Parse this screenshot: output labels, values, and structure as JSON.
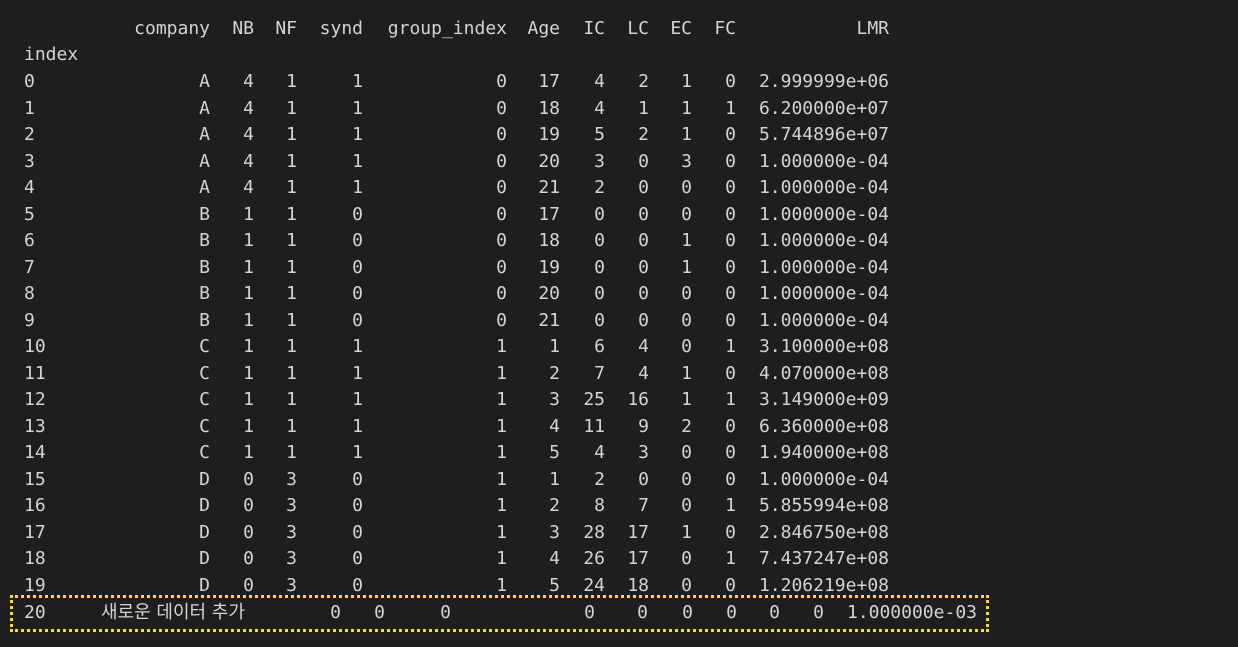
{
  "terminal": {
    "columns": [
      "company",
      "NB",
      "NF",
      "synd",
      "group_index",
      "Age",
      "IC",
      "LC",
      "EC",
      "FC",
      "LMR"
    ],
    "index_label": "index",
    "rows": [
      [
        "0",
        "A",
        "4",
        "1",
        "1",
        "0",
        "17",
        "4",
        "2",
        "1",
        "0",
        "2.999999e+06"
      ],
      [
        "1",
        "A",
        "4",
        "1",
        "1",
        "0",
        "18",
        "4",
        "1",
        "1",
        "1",
        "6.200000e+07"
      ],
      [
        "2",
        "A",
        "4",
        "1",
        "1",
        "0",
        "19",
        "5",
        "2",
        "1",
        "0",
        "5.744896e+07"
      ],
      [
        "3",
        "A",
        "4",
        "1",
        "1",
        "0",
        "20",
        "3",
        "0",
        "3",
        "0",
        "1.000000e-04"
      ],
      [
        "4",
        "A",
        "4",
        "1",
        "1",
        "0",
        "21",
        "2",
        "0",
        "0",
        "0",
        "1.000000e-04"
      ],
      [
        "5",
        "B",
        "1",
        "1",
        "0",
        "0",
        "17",
        "0",
        "0",
        "0",
        "0",
        "1.000000e-04"
      ],
      [
        "6",
        "B",
        "1",
        "1",
        "0",
        "0",
        "18",
        "0",
        "0",
        "1",
        "0",
        "1.000000e-04"
      ],
      [
        "7",
        "B",
        "1",
        "1",
        "0",
        "0",
        "19",
        "0",
        "0",
        "1",
        "0",
        "1.000000e-04"
      ],
      [
        "8",
        "B",
        "1",
        "1",
        "0",
        "0",
        "20",
        "0",
        "0",
        "0",
        "0",
        "1.000000e-04"
      ],
      [
        "9",
        "B",
        "1",
        "1",
        "0",
        "0",
        "21",
        "0",
        "0",
        "0",
        "0",
        "1.000000e-04"
      ],
      [
        "10",
        "C",
        "1",
        "1",
        "1",
        "1",
        "1",
        "6",
        "4",
        "0",
        "1",
        "3.100000e+08"
      ],
      [
        "11",
        "C",
        "1",
        "1",
        "1",
        "1",
        "2",
        "7",
        "4",
        "1",
        "0",
        "4.070000e+08"
      ],
      [
        "12",
        "C",
        "1",
        "1",
        "1",
        "1",
        "3",
        "25",
        "16",
        "1",
        "1",
        "3.149000e+09"
      ],
      [
        "13",
        "C",
        "1",
        "1",
        "1",
        "1",
        "4",
        "11",
        "9",
        "2",
        "0",
        "6.360000e+08"
      ],
      [
        "14",
        "C",
        "1",
        "1",
        "1",
        "1",
        "5",
        "4",
        "3",
        "0",
        "0",
        "1.940000e+08"
      ],
      [
        "15",
        "D",
        "0",
        "3",
        "0",
        "1",
        "1",
        "2",
        "0",
        "0",
        "0",
        "1.000000e-04"
      ],
      [
        "16",
        "D",
        "0",
        "3",
        "0",
        "1",
        "2",
        "8",
        "7",
        "0",
        "1",
        "5.855994e+08"
      ],
      [
        "17",
        "D",
        "0",
        "3",
        "0",
        "1",
        "3",
        "28",
        "17",
        "1",
        "0",
        "2.846750e+08"
      ],
      [
        "18",
        "D",
        "0",
        "3",
        "0",
        "1",
        "4",
        "26",
        "17",
        "0",
        "1",
        "7.437247e+08"
      ],
      [
        "19",
        "D",
        "0",
        "3",
        "0",
        "1",
        "5",
        "24",
        "18",
        "0",
        "0",
        "1.206219e+08"
      ]
    ],
    "new_row": {
      "index": "20",
      "company": "새로운 데이터 추가",
      "NB": "0",
      "NF": "0",
      "synd": "0",
      "group_index": "0",
      "Age": "0",
      "IC": "0",
      "LC": "0",
      "EC": "0",
      "FC": "0",
      "LMR": "1.000000e-03"
    },
    "colors": {
      "background": "#1e1e1e",
      "text": "#d4d4d4",
      "highlight_border": "#ffe000"
    }
  }
}
